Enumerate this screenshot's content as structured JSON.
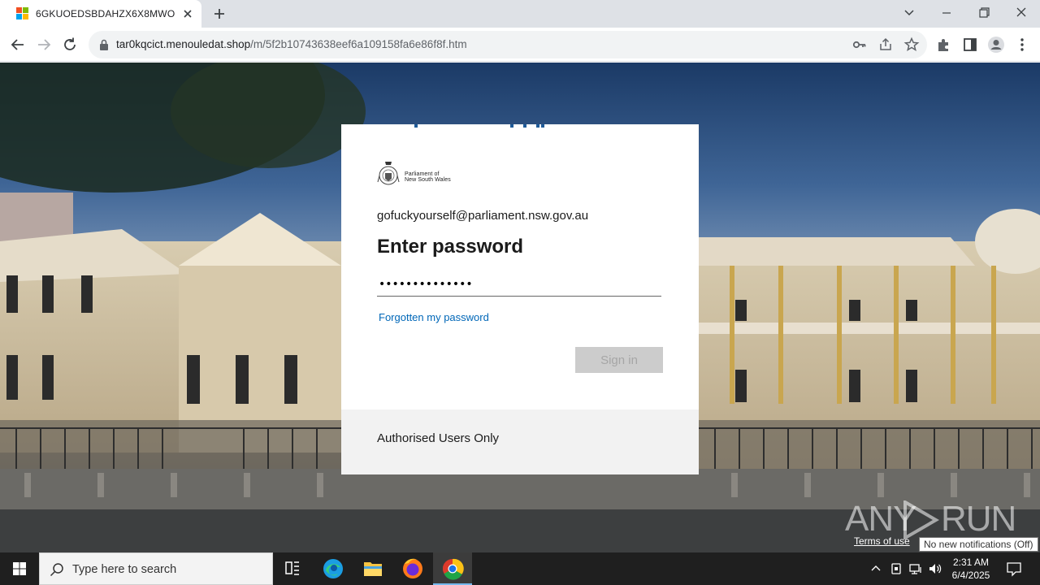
{
  "browser": {
    "tab_title": "6GKUOEDSBDAHZX6X8MWO",
    "url_host": "tar0kqcict.menouledat.shop",
    "url_path": "/m/5f2b10743638eef6a109158fa6e86f8f.htm"
  },
  "page": {
    "logo_line1": "Parliament of",
    "logo_line2": "New South Wales",
    "email": "gofuckyourself@parliament.nsw.gov.au",
    "heading": "Enter password",
    "password_value": "••••••••••••••",
    "forgot_link": "Forgotten my password",
    "signin_button": "Sign in",
    "footer_text": "Authorised Users Only",
    "terms": "Terms of use",
    "watermark_left": "ANY",
    "watermark_right": "RUN"
  },
  "tooltip": "No new notifications (Off)",
  "taskbar": {
    "search_placeholder": "Type here to search",
    "time": "2:31 AM",
    "date": "6/4/2025"
  },
  "colors": {
    "link": "#0067b8",
    "taskbar": "#1f1f1f",
    "tab_strip": "#dee1e6"
  }
}
